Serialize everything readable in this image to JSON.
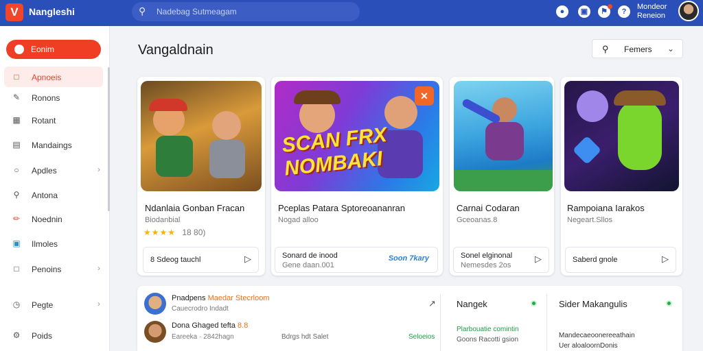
{
  "header": {
    "logo_glyph": "V",
    "brand": "Nangleshi",
    "search_placeholder": "Nadebag Sutmeagam",
    "search_icon": "search-icon",
    "icons": [
      "chat-icon",
      "gift-icon",
      "notification-icon",
      "help-icon"
    ],
    "user_name": "Mondeor",
    "user_sub": "Reneion"
  },
  "sidebar": {
    "primary_label": "Eonim",
    "items": [
      {
        "label": "Apnoeis",
        "icon": "gamepad-icon",
        "active": true,
        "chevron": false
      },
      {
        "label": "Ronons",
        "icon": "pen-icon",
        "active": false,
        "chevron": false
      },
      {
        "label": "Rotant",
        "icon": "grid-icon",
        "active": false,
        "chevron": false
      },
      {
        "label": "Mandaings",
        "icon": "document-icon",
        "active": false,
        "chevron": false
      },
      {
        "label": "Apdles",
        "icon": "circle-icon",
        "active": false,
        "chevron": true
      },
      {
        "label": "Antona",
        "icon": "tool-icon",
        "active": false,
        "chevron": false
      },
      {
        "label": "Noednin",
        "icon": "pencil-icon",
        "active": false,
        "chevron": false
      },
      {
        "label": "Ilmoles",
        "icon": "image-icon",
        "active": false,
        "chevron": false
      },
      {
        "label": "Penoins",
        "icon": "note-icon",
        "active": false,
        "chevron": true
      },
      {
        "label": "Pegte",
        "icon": "clock-icon",
        "active": false,
        "chevron": true
      },
      {
        "label": "Poids",
        "icon": "settings-icon",
        "active": false,
        "chevron": false
      }
    ]
  },
  "main": {
    "page_title": "Vangaldnain",
    "filter_label": "Femers",
    "cards": [
      {
        "title": "Ndanlaia Gonban Fracan",
        "sub": "Biodanbial",
        "stars": "★★★★",
        "rating": "18 80)",
        "foot1": "8 Sdeog tauchl",
        "foot2": "",
        "tag": "",
        "banner": ""
      },
      {
        "title": "Pceplas Patara Sptoreoananran",
        "sub": "Nogad alloo",
        "stars": "",
        "rating": "",
        "foot1": "Sonard de inood",
        "foot2": "Gene daan.001",
        "tag": "Soon 7kary",
        "banner": "SCAN FRX NOMBAKI"
      },
      {
        "title": "Carnai Codaran",
        "sub": "Gceoanas.8",
        "stars": "",
        "rating": "",
        "foot1": "Sonel elginonal",
        "foot2": "Nemesdes 2os",
        "tag": "",
        "banner": ""
      },
      {
        "title": "Rampoiana Iarakos",
        "sub": "Negeart.Sllos",
        "stars": "",
        "rating": "",
        "foot1": "Saberd gnole",
        "foot2": "",
        "tag": "",
        "banner": ""
      }
    ]
  },
  "panel": {
    "rows": [
      {
        "title": "Pnadpens",
        "highlight": "Maedar Stecrloom",
        "sub": "Cauecrodro Indadt",
        "mid": "",
        "green": ""
      },
      {
        "title": "Dona Ghaged tefta",
        "highlight": "8.8",
        "sub": "Eareeka · 2842hagn",
        "mid": "Bdrgs hdt Salet",
        "green": "Seloeios"
      }
    ],
    "col2_title": "Nangek",
    "col2_line1": "Plarbouatie comintin",
    "col2_line2": "Goons Racotti gsion",
    "col3_title": "Sider Makangulis",
    "col3_line1": "Mandecaeoonereeathain",
    "col3_line2": "Uer aloaloornDonis"
  }
}
